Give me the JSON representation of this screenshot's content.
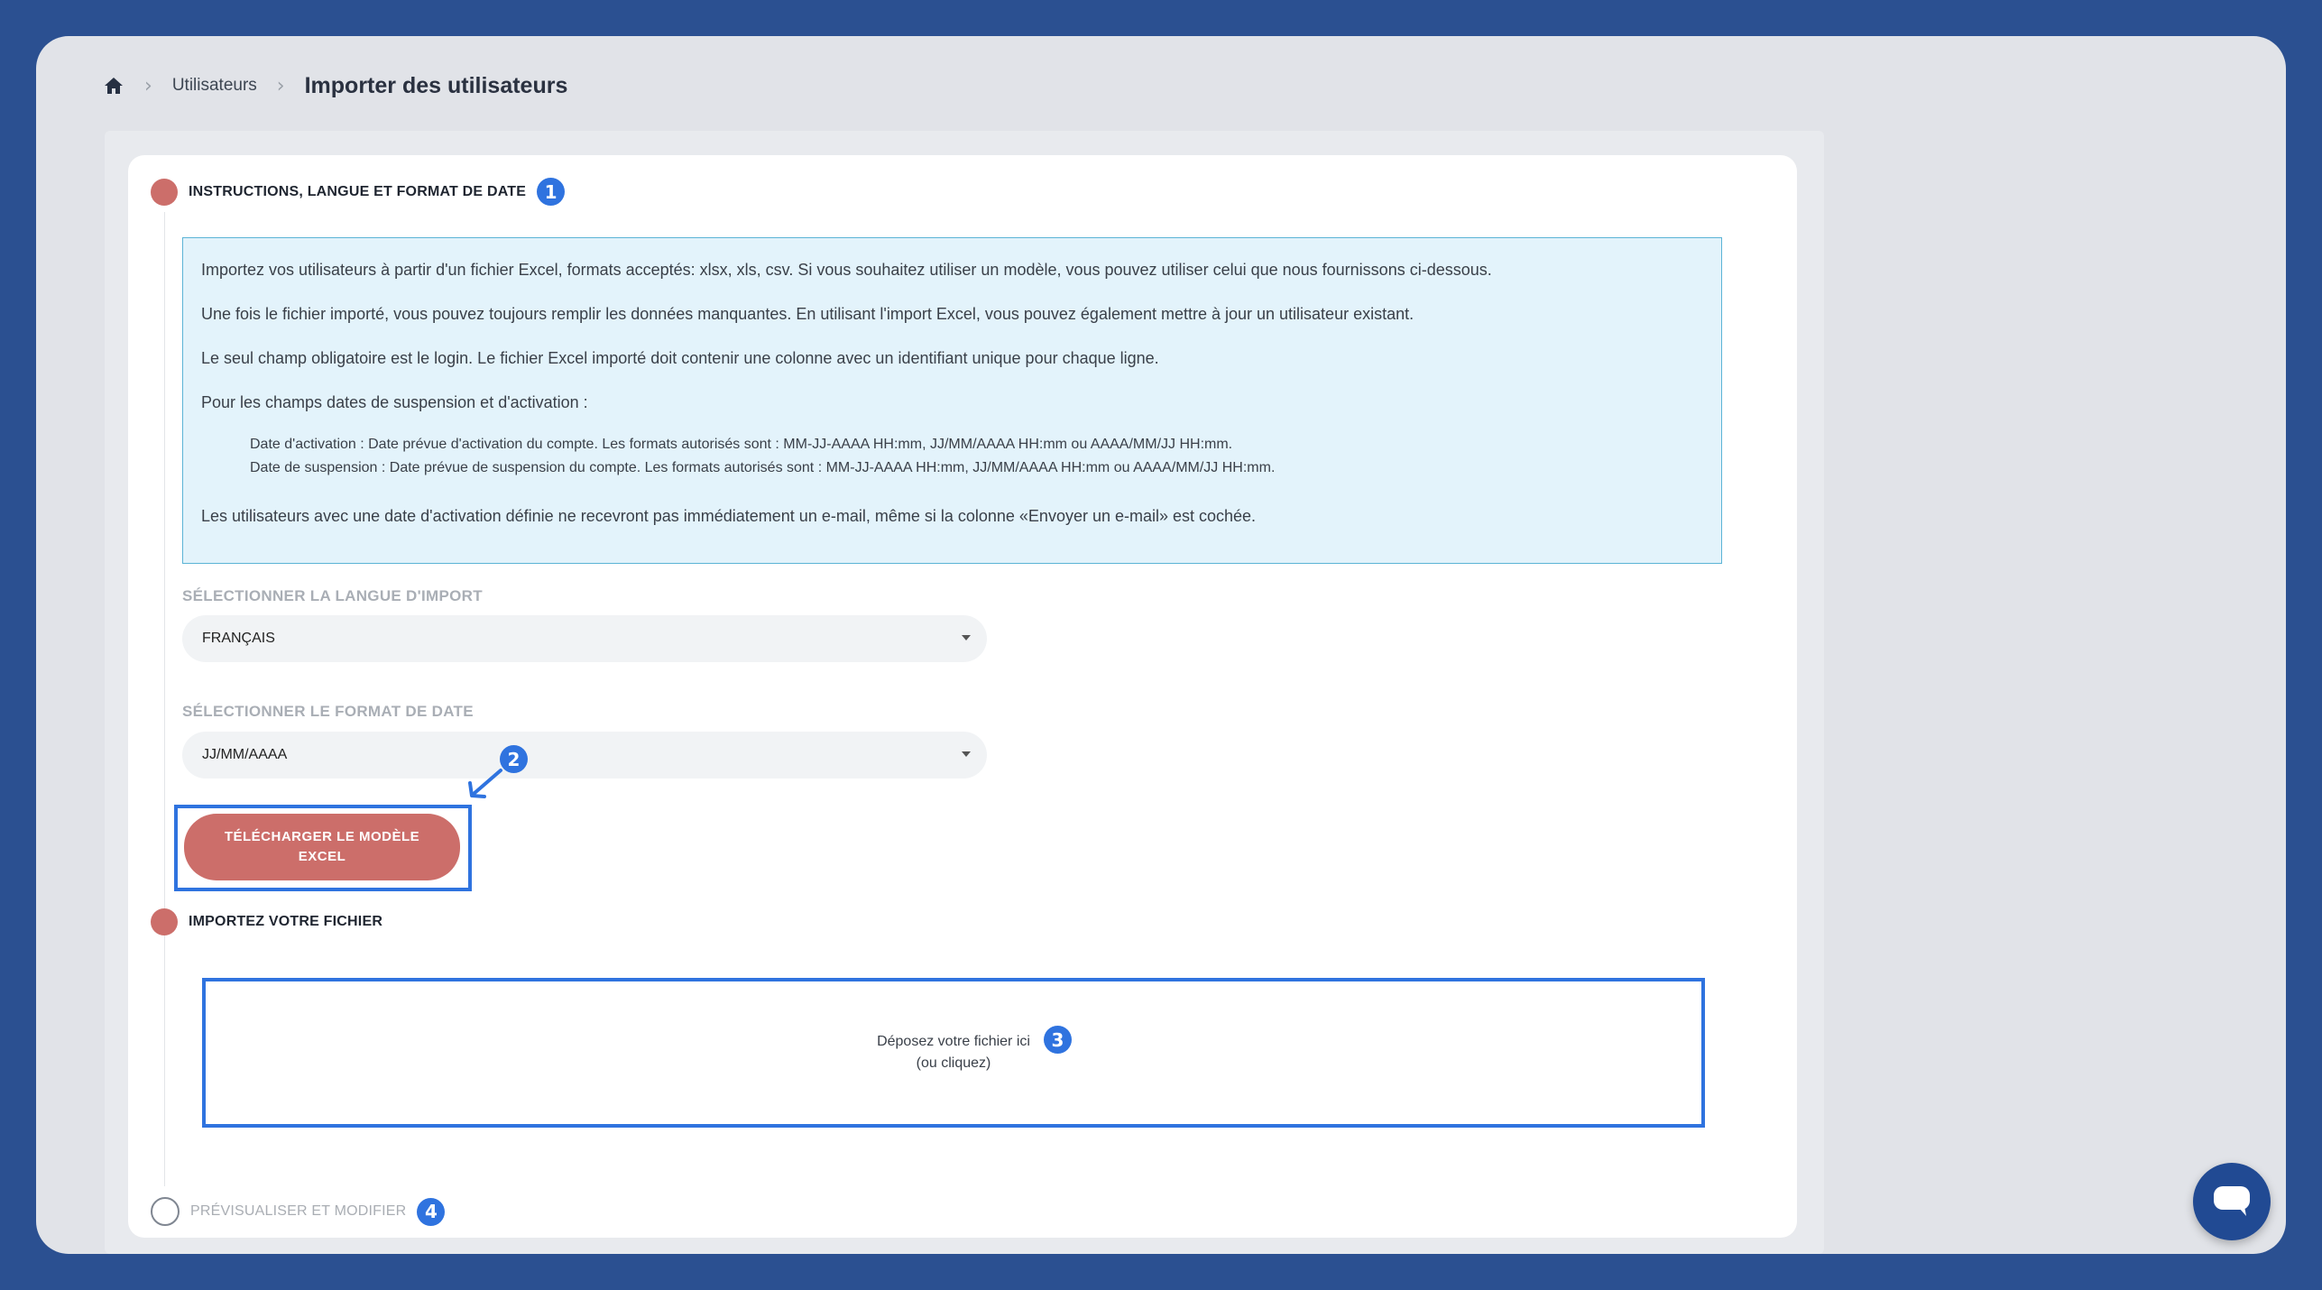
{
  "breadcrumb": {
    "home_icon": "home-icon",
    "parent": "Utilisateurs",
    "current": "Importer des utilisateurs"
  },
  "steps": [
    {
      "title": "INSTRUCTIONS, LANGUE ET FORMAT DE DATE",
      "badge": "1",
      "state": "active"
    },
    {
      "title": "IMPORTEZ VOTRE FICHIER",
      "state": "active"
    },
    {
      "title": "PRÉVISUALISER ET MODIFIER",
      "badge": "4",
      "state": "inactive"
    }
  ],
  "instructions": {
    "p1": "Importez vos utilisateurs à partir d'un fichier Excel, formats acceptés: xlsx, xls, csv. Si vous souhaitez utiliser un modèle, vous pouvez utiliser celui que nous fournissons ci-dessous.",
    "p2": "Une fois le fichier importé, vous pouvez toujours remplir les données manquantes. En utilisant l'import Excel, vous pouvez également mettre à jour un utilisateur existant.",
    "p3": "Le seul champ obligatoire est le login. Le fichier Excel importé doit contenir une colonne avec un identifiant unique pour chaque ligne.",
    "p4": "Pour les champs dates de suspension et d'activation :",
    "p5": "Date d'activation : Date prévue d'activation du compte. Les formats autorisés sont : MM-JJ-AAAA HH:mm, JJ/MM/AAAA HH:mm ou AAAA/MM/JJ HH:mm.",
    "p6": "Date de suspension : Date prévue de suspension du compte. Les formats autorisés sont : MM-JJ-AAAA HH:mm, JJ/MM/AAAA HH:mm ou AAAA/MM/JJ HH:mm.",
    "p7": "Les utilisateurs avec une date d'activation définie ne recevront pas immédiatement un e-mail, même si la colonne «Envoyer un e-mail» est cochée."
  },
  "language_select": {
    "label": "SÉLECTIONNER LA LANGUE D'IMPORT",
    "value": "FRANÇAIS"
  },
  "date_format_select": {
    "label": "SÉLECTIONNER LE FORMAT DE DATE",
    "value": "JJ/MM/AAAA",
    "badge": "2"
  },
  "download_button": {
    "label": "TÉLÉCHARGER LE MODÈLE EXCEL"
  },
  "dropzone": {
    "line1": "Déposez votre fichier ici",
    "line2": "(ou cliquez)",
    "badge": "3"
  },
  "chat": {
    "icon": "chat-bubble-icon"
  },
  "colors": {
    "accent_blue": "#2f73df",
    "step_dot": "#cc6e6a",
    "button": "#cc6e6a",
    "info_bg": "#e3f3fb",
    "info_border": "#5cb4d6",
    "page_bg": "#2b5091"
  }
}
